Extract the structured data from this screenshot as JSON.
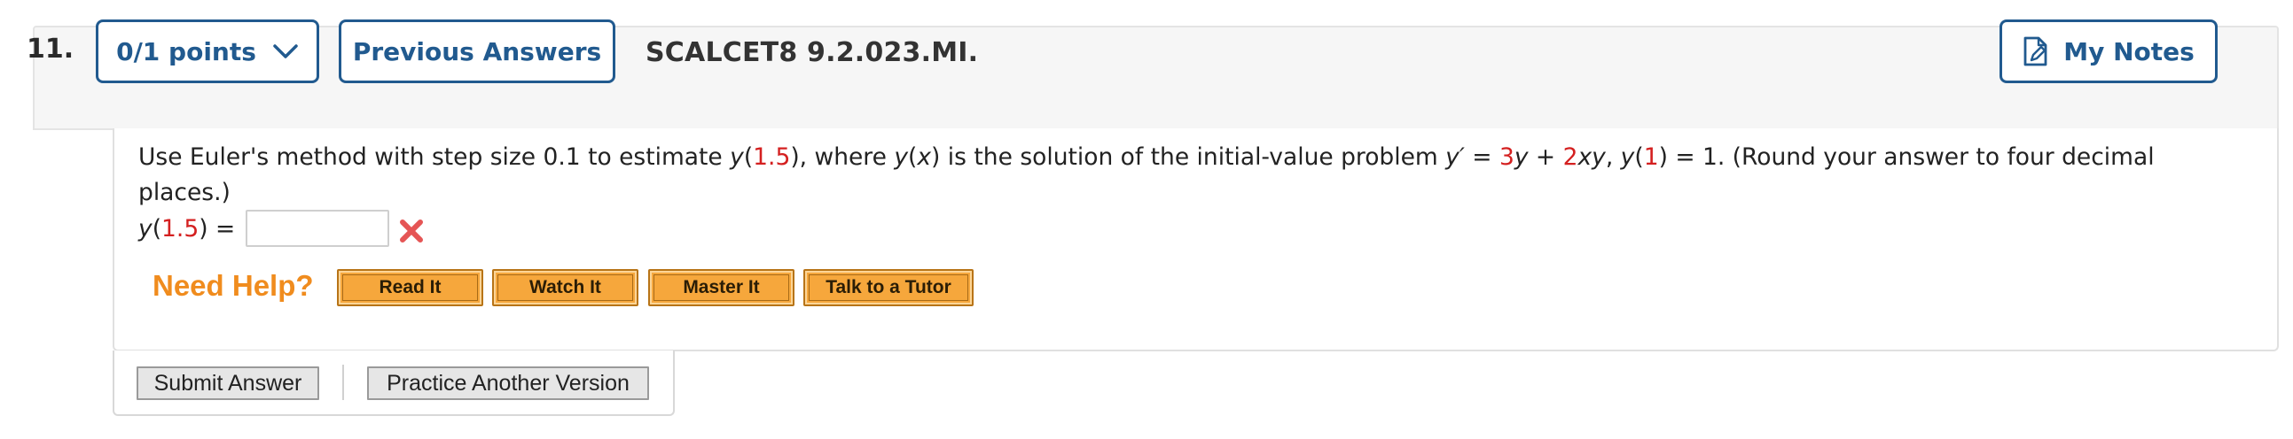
{
  "question": {
    "number": "11.",
    "points_label": "0/1 points",
    "previous_answers_label": "Previous Answers",
    "code": "SCALCET8 9.2.023.MI.",
    "my_notes_label": "My Notes"
  },
  "prompt": {
    "t1": "Use Euler's method with step size 0.1 to estimate ",
    "y1": "y",
    "p1": "(",
    "v1": "1.5",
    "p2": "), where ",
    "y2": "y",
    "p3": "(",
    "x1": "x",
    "p4": ") is the solution of the initial-value problem ",
    "yprime": "y′",
    "eq1": " = ",
    "c3": "3",
    "y3": "y",
    "plus": " + ",
    "c2": "2",
    "xy": "xy",
    "comma": ", ",
    "y4": "y",
    "p5": "(",
    "c1": "1",
    "p6": ") = 1. (Round your answer to four decimal places.)"
  },
  "answer": {
    "lhs_y": "y",
    "lhs_open": "(",
    "lhs_val": "1.5",
    "lhs_close": ") =",
    "value": "",
    "status": "incorrect"
  },
  "help": {
    "label": "Need Help?",
    "read": "Read It",
    "watch": "Watch It",
    "master": "Master It",
    "tutor": "Talk to a Tutor"
  },
  "actions": {
    "submit": "Submit Answer",
    "practice": "Practice Another Version"
  },
  "colors": {
    "accent_blue": "#215a8f",
    "highlight_red": "#d42020",
    "help_orange": "#f08c1e",
    "help_button": "#f6a73c"
  },
  "icons": {
    "points_dropdown": "chevron-down-icon",
    "my_notes": "note-edit-icon",
    "wrong": "x-mark-icon"
  }
}
